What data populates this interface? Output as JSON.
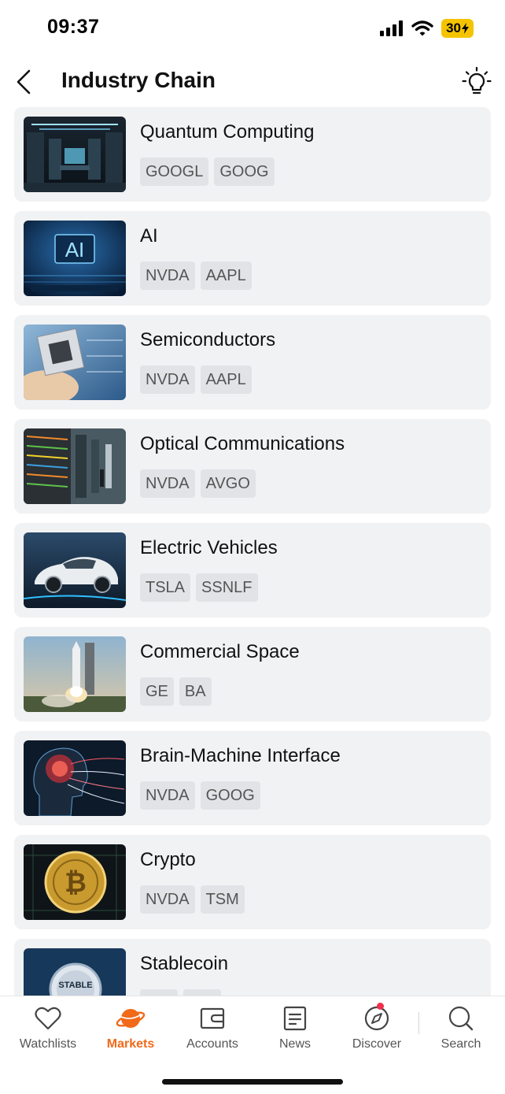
{
  "status": {
    "time": "09:37",
    "battery": "30"
  },
  "header": {
    "title": "Industry Chain"
  },
  "industries": [
    {
      "name": "Quantum Computing",
      "tags": [
        "GOOGL",
        "GOOG"
      ],
      "image_icon": "server-room"
    },
    {
      "name": "AI",
      "tags": [
        "NVDA",
        "AAPL"
      ],
      "image_icon": "ai-chip",
      "image_text": "AI"
    },
    {
      "name": "Semiconductors",
      "tags": [
        "NVDA",
        "AAPL"
      ],
      "image_icon": "microchip"
    },
    {
      "name": "Optical Communications",
      "tags": [
        "NVDA",
        "AVGO"
      ],
      "image_icon": "fiber-racks"
    },
    {
      "name": "Electric Vehicles",
      "tags": [
        "TSLA",
        "SSNLF"
      ],
      "image_icon": "electric-car"
    },
    {
      "name": "Commercial Space",
      "tags": [
        "GE",
        "BA"
      ],
      "image_icon": "rocket-launch"
    },
    {
      "name": "Brain-Machine Interface",
      "tags": [
        "NVDA",
        "GOOG"
      ],
      "image_icon": "brain-head"
    },
    {
      "name": "Crypto",
      "tags": [
        "NVDA",
        "TSM"
      ],
      "image_icon": "bitcoin-coin"
    },
    {
      "name": "Stablecoin",
      "tags": [
        "",
        ""
      ],
      "image_icon": "stable-coin",
      "image_text": "STABLE"
    }
  ],
  "tabbar": {
    "items": [
      {
        "label": "Watchlists",
        "icon": "heart-icon"
      },
      {
        "label": "Markets",
        "icon": "planet-icon",
        "active": true
      },
      {
        "label": "Accounts",
        "icon": "wallet-icon"
      },
      {
        "label": "News",
        "icon": "news-icon"
      },
      {
        "label": "Discover",
        "icon": "compass-icon",
        "badge_dot": true
      },
      {
        "label": "Search",
        "icon": "search-icon"
      }
    ]
  },
  "colors": {
    "accent": "#f06a1a",
    "card_bg": "#f1f2f4",
    "tag_bg": "#e2e3e6",
    "badge_dot": "#f0304a",
    "battery": "#f5c400"
  }
}
